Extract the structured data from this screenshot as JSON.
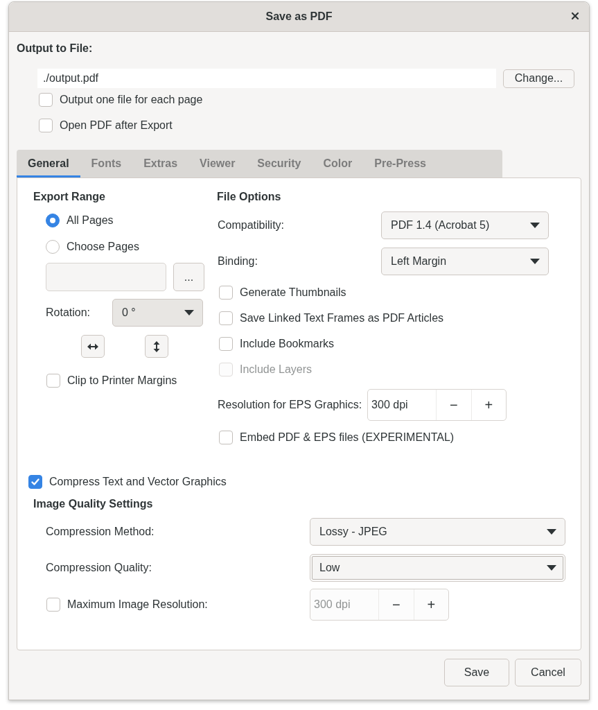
{
  "window": {
    "title": "Save as PDF"
  },
  "output": {
    "heading": "Output to File:",
    "path": "./output.pdf",
    "change_button": "Change...",
    "options": [
      {
        "label": "Output one file for each page",
        "checked": false
      },
      {
        "label": "Open PDF after Export",
        "checked": false
      }
    ]
  },
  "tabs": [
    {
      "label": "General",
      "selected": true
    },
    {
      "label": "Fonts",
      "selected": false
    },
    {
      "label": "Extras",
      "selected": false
    },
    {
      "label": "Viewer",
      "selected": false
    },
    {
      "label": "Security",
      "selected": false
    },
    {
      "label": "Color",
      "selected": false
    },
    {
      "label": "Pre-Press",
      "selected": false
    }
  ],
  "export_range": {
    "heading": "Export Range",
    "options": [
      {
        "label": "All Pages",
        "selected": true
      },
      {
        "label": "Choose Pages",
        "selected": false
      }
    ],
    "browse_button": "...",
    "rotation": {
      "label": "Rotation:",
      "value": "0 °"
    },
    "clip": {
      "label": "Clip to Printer Margins",
      "checked": false
    }
  },
  "file_options": {
    "heading": "File Options",
    "compatibility": {
      "label": "Compatibility:",
      "value": "PDF 1.4 (Acrobat 5)"
    },
    "binding": {
      "label": "Binding:",
      "value": "Left Margin"
    },
    "rows": [
      {
        "kind": "check",
        "label": "Generate Thumbnails",
        "checked": false,
        "disabled": false
      },
      {
        "kind": "check",
        "label": "Save Linked Text Frames as PDF Articles",
        "checked": false,
        "disabled": false
      },
      {
        "kind": "check",
        "label": "Include Bookmarks",
        "checked": false,
        "disabled": false
      },
      {
        "kind": "check",
        "label": "Include Layers",
        "checked": false,
        "disabled": true
      },
      {
        "kind": "spin",
        "label": "Resolution for EPS Graphics:",
        "value": "300 dpi",
        "decrement": "−",
        "increment": "+",
        "disabled": false
      },
      {
        "kind": "check",
        "label": "Embed PDF & EPS files (EXPERIMENTAL)",
        "checked": false,
        "disabled": false
      }
    ]
  },
  "compress": {
    "label": "Compress Text and Vector Graphics",
    "checked": true
  },
  "image_quality": {
    "heading": "Image Quality Settings",
    "method": {
      "label": "Compression Method:",
      "value": "Lossy - JPEG",
      "focused": false
    },
    "quality": {
      "label": "Compression Quality:",
      "value": "Low",
      "focused": true
    },
    "max_resolution": {
      "label": "Maximum Image Resolution:",
      "checked": false,
      "field": {
        "value": "300 dpi",
        "decrement": "−",
        "increment": "+",
        "disabled": true
      }
    }
  },
  "buttons": [
    "Save",
    "Cancel"
  ]
}
